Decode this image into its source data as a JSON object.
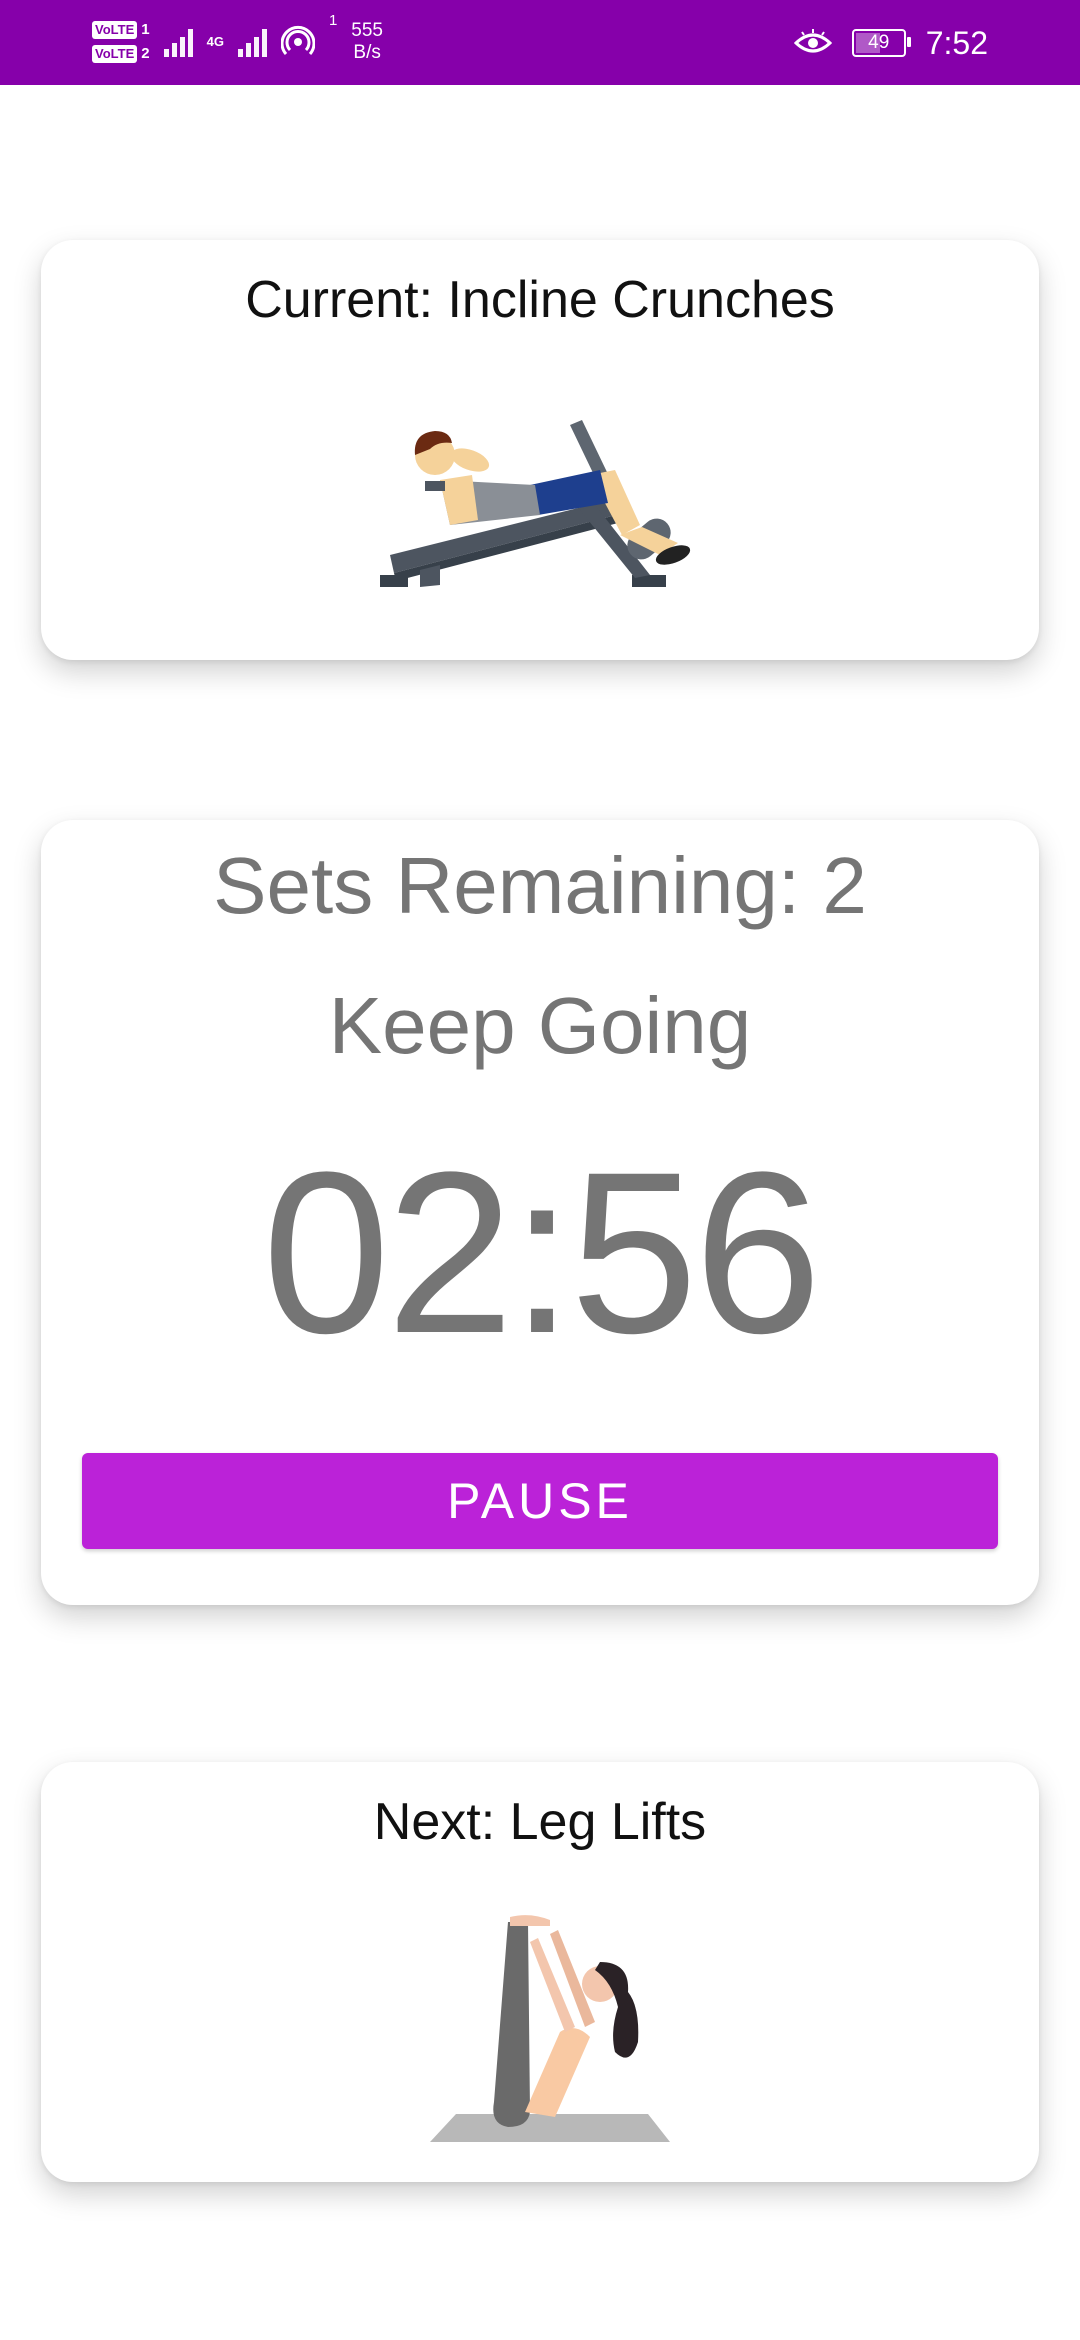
{
  "status_bar": {
    "sim1": "VoLTE",
    "sim1_slot": "1",
    "sim2": "VoLTE",
    "sim2_slot": "2",
    "network": "4G",
    "hotspot_count": "1",
    "speed_value": "555",
    "speed_unit": "B/s",
    "battery": "49",
    "time": "7:52",
    "eye_icon": "eye-comfort-icon",
    "background": "#8600aa"
  },
  "current_card": {
    "title": "Current: Incline Crunches",
    "illustration": "incline-crunches-illustration"
  },
  "timer_card": {
    "sets_remaining": "Sets Remaining: 2",
    "motivation": "Keep Going",
    "countdown": "02:56",
    "pause_label": "PAUSE",
    "accent": "#bb22d8"
  },
  "next_card": {
    "title": "Next: Leg Lifts",
    "illustration": "leg-lifts-illustration"
  }
}
